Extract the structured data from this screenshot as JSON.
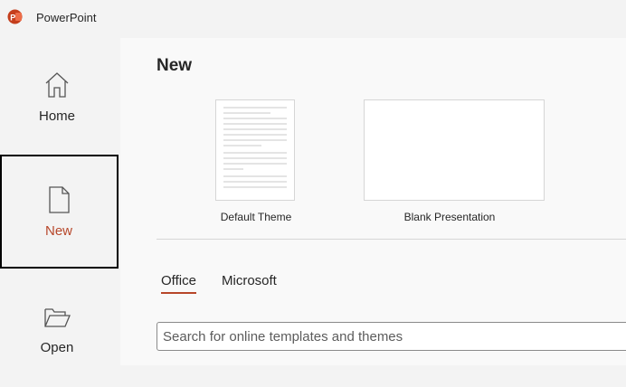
{
  "app": {
    "title": "PowerPoint",
    "accent": "#b7472a",
    "logo_color": "#c43e1c"
  },
  "sidebar": {
    "items": [
      {
        "label": "Home",
        "icon": "home-icon",
        "selected": false
      },
      {
        "label": "New",
        "icon": "new-document-icon",
        "selected": true
      },
      {
        "label": "Open",
        "icon": "folder-open-icon",
        "selected": false
      }
    ]
  },
  "main": {
    "title": "New",
    "templates": [
      {
        "label": "Default Theme"
      },
      {
        "label": "Blank Presentation"
      }
    ],
    "tabs": [
      {
        "label": "Office",
        "active": true
      },
      {
        "label": "Microsoft",
        "active": false
      }
    ],
    "search": {
      "placeholder": "Search for online templates and themes",
      "value": ""
    }
  }
}
